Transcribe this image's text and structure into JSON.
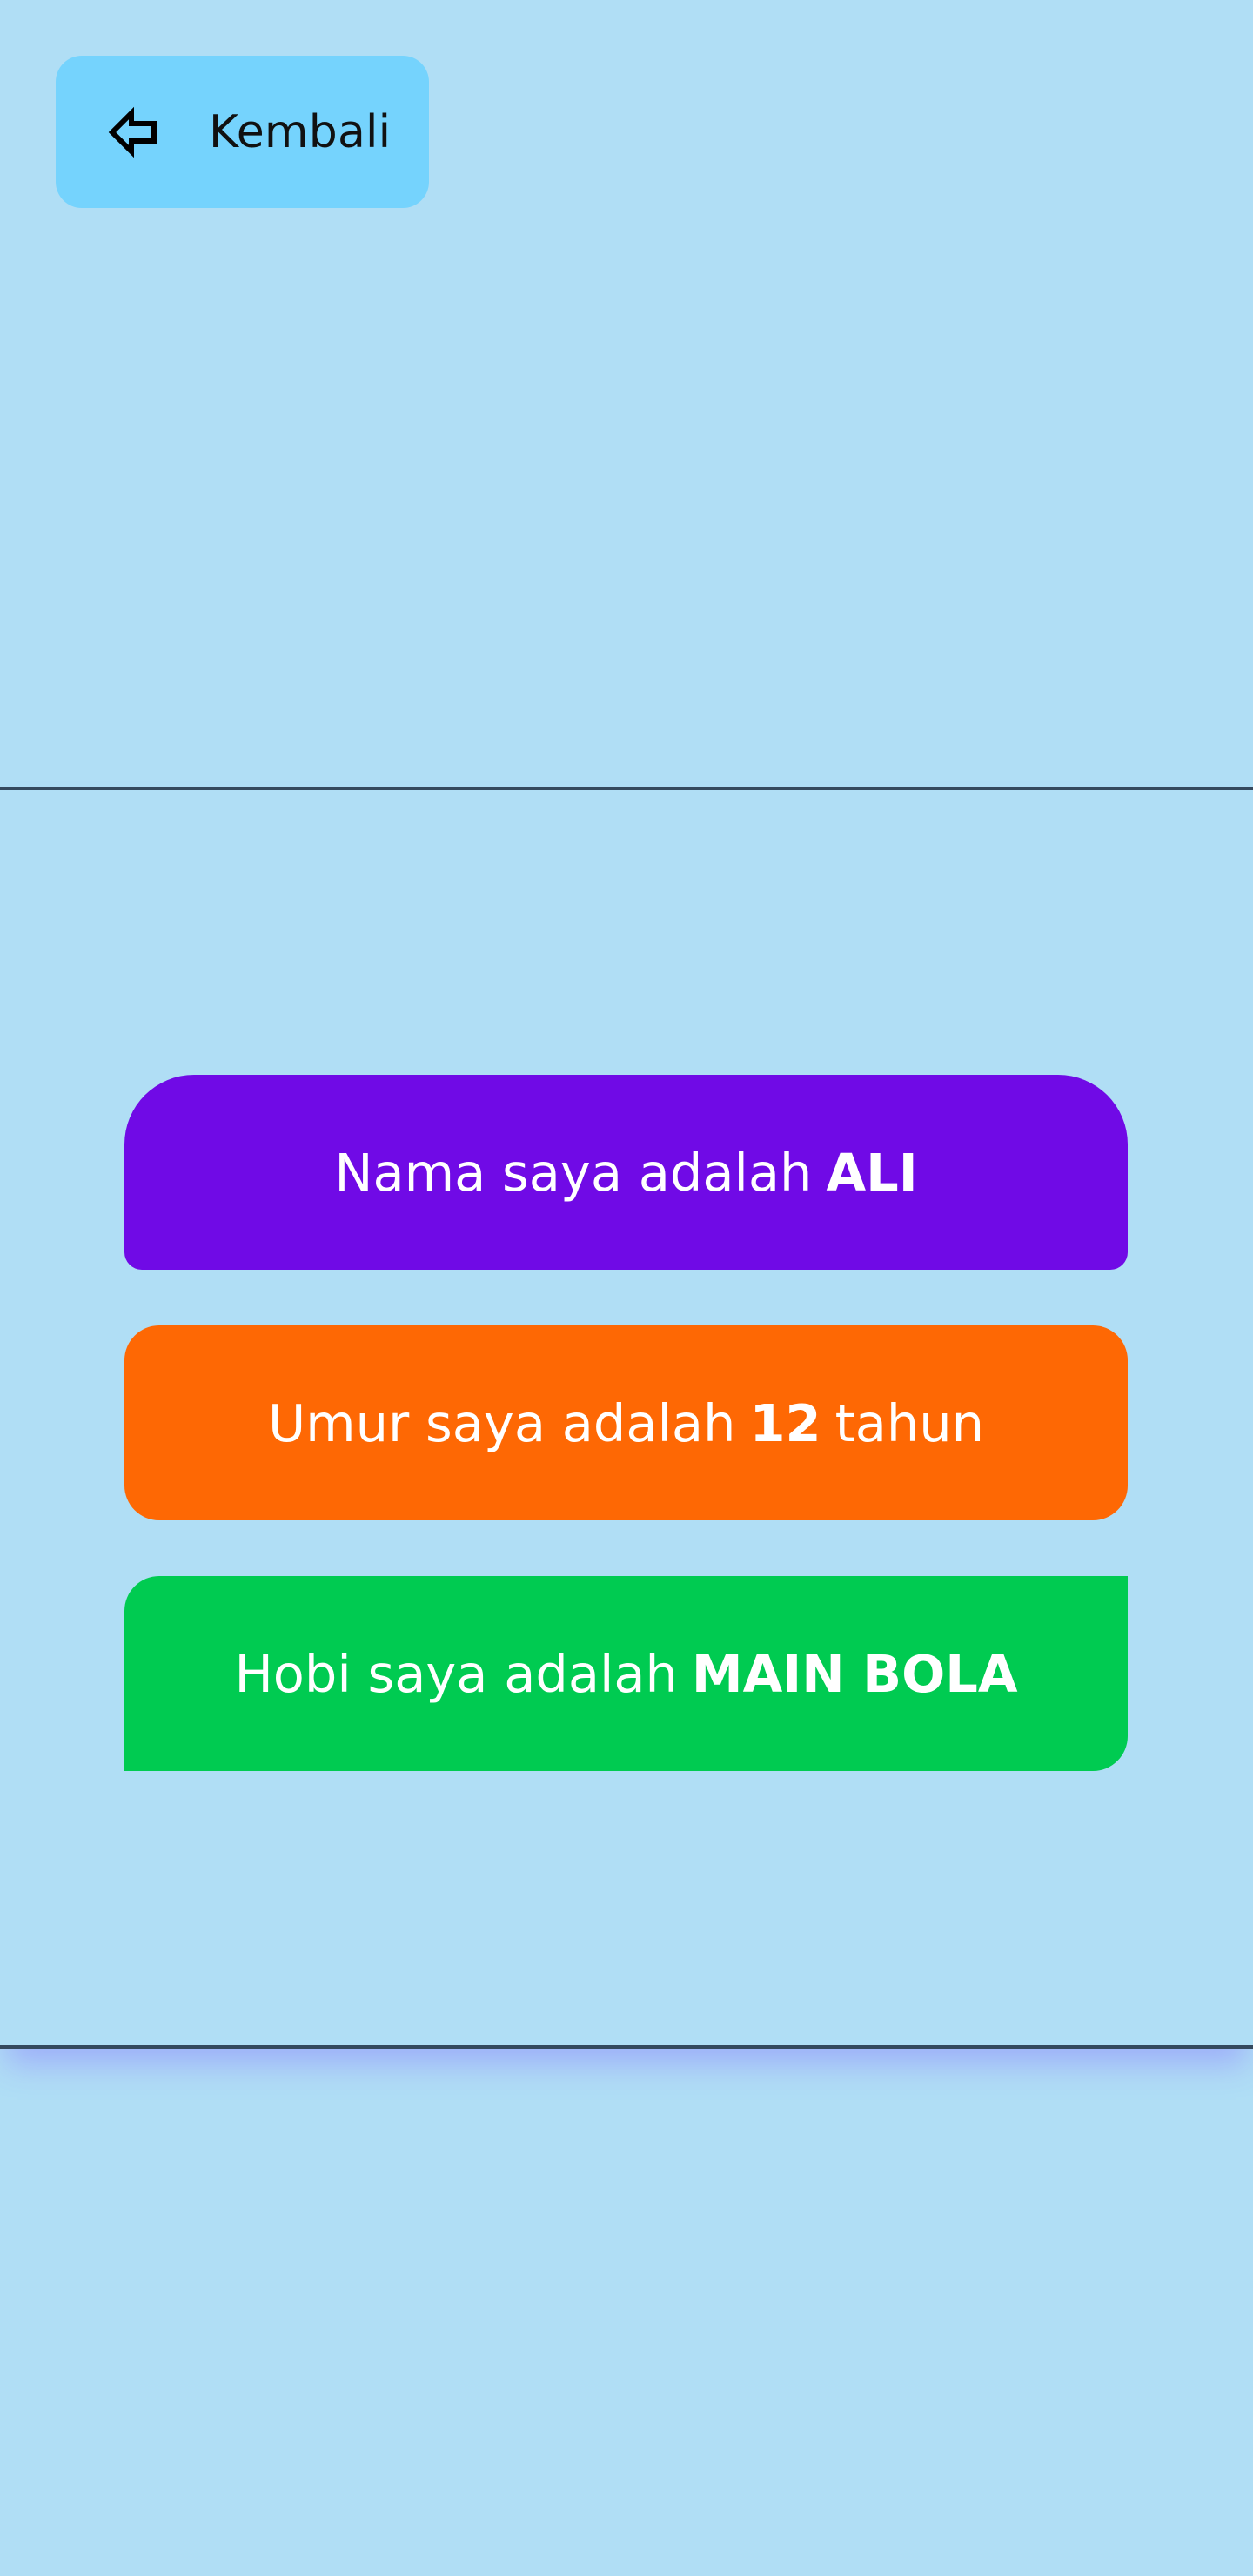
{
  "back_button": {
    "label": "Kembali",
    "icon": "arrow-left-icon"
  },
  "cards": {
    "name": {
      "prefix": "Nama saya adalah",
      "value": "ALI",
      "suffix": "",
      "color": "#700ae6"
    },
    "age": {
      "prefix": "Umur saya adalah",
      "value": "12",
      "suffix": "tahun",
      "color": "#fe6804"
    },
    "hobby": {
      "prefix": "Hobi saya adalah",
      "value": "MAIN BOLA",
      "suffix": "",
      "color": "#00cb51"
    }
  },
  "colors": {
    "background": "#b0def5",
    "back_button": "#75d3fd",
    "divider": "#34495e"
  }
}
